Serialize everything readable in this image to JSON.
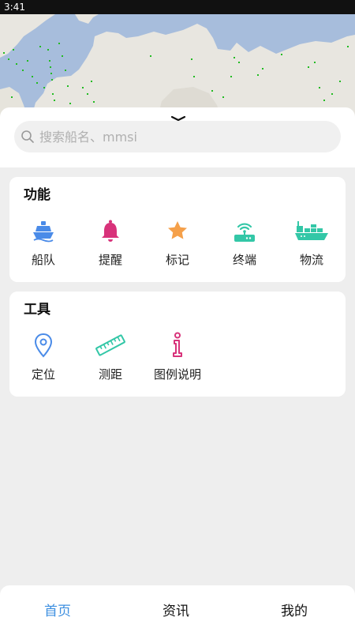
{
  "status_bar": {
    "time": "3:41"
  },
  "search": {
    "placeholder": "搜索船名、mmsi"
  },
  "functions": {
    "title": "功能",
    "items": [
      {
        "label": "船队",
        "icon": "ship-icon",
        "color": "#4a8be8"
      },
      {
        "label": "提醒",
        "icon": "bell-icon",
        "color": "#d8327a"
      },
      {
        "label": "标记",
        "icon": "star-icon",
        "color": "#f5a04a"
      },
      {
        "label": "终端",
        "icon": "router-icon",
        "color": "#33c7a7"
      },
      {
        "label": "物流",
        "icon": "cargo-ship-icon",
        "color": "#33c7a7"
      }
    ]
  },
  "tools": {
    "title": "工具",
    "items": [
      {
        "label": "定位",
        "icon": "location-pin-icon",
        "color": "#4a8be8"
      },
      {
        "label": "测距",
        "icon": "ruler-icon",
        "color": "#33c7a7"
      },
      {
        "label": "图例说明",
        "icon": "info-icon",
        "color": "#d8327a"
      }
    ]
  },
  "tabs": [
    {
      "label": "首页",
      "active": true
    },
    {
      "label": "资讯",
      "active": false
    },
    {
      "label": "我的",
      "active": false
    }
  ],
  "colors": {
    "accent": "#3d8fe0",
    "map_sea": "#a7bddc",
    "map_land": "#e8e6e0",
    "vessel": "#22bb22"
  }
}
